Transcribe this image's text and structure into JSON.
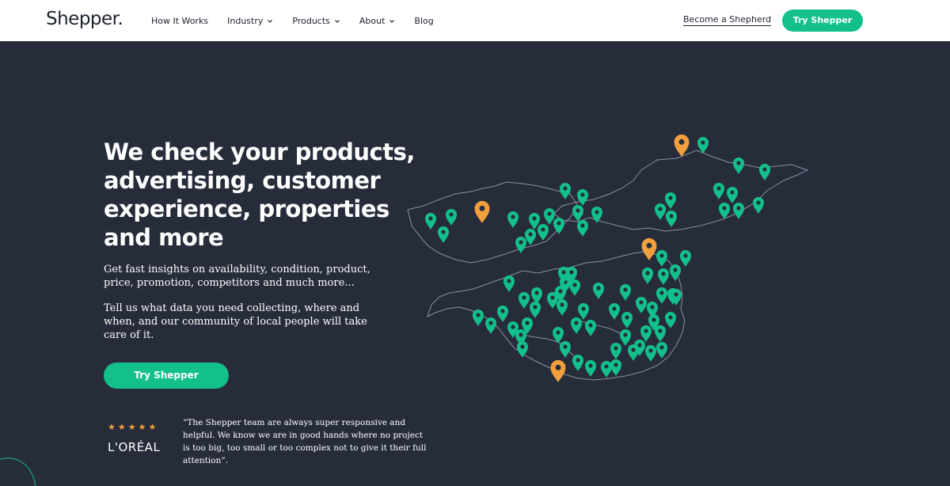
{
  "header": {
    "logo": "Shepper",
    "nav": [
      {
        "label": "How It Works",
        "has_dropdown": false
      },
      {
        "label": "Industry",
        "has_dropdown": true
      },
      {
        "label": "Products",
        "has_dropdown": true
      },
      {
        "label": "About",
        "has_dropdown": true
      },
      {
        "label": "Blog",
        "has_dropdown": false
      }
    ],
    "become_link": "Become a Shepherd",
    "cta": "Try Shepper"
  },
  "hero": {
    "title_lines": [
      "We check your products,",
      "advertising, customer",
      "experience, properties",
      "and more"
    ],
    "para1_lines": [
      "Get fast insights on availability, condition, product,",
      "price, promotion, competitors and much more..."
    ],
    "para2_lines": [
      "Tell us what data you need collecting, where and",
      "when, and our community of local people will take",
      "care of it."
    ],
    "cta": "Try Shepper"
  },
  "testimonial": {
    "stars": "★★★★★",
    "brand": "L'ORÉAL",
    "quote_lines": [
      "“The Shepper team are always super responsive and",
      "helpful. We know we are in good hands where no project",
      "is too big, too small or too complex not to give it their full",
      "attention”."
    ]
  },
  "map": {
    "pin_colors": {
      "primary": "#13c08b",
      "highlight": "#f2a03d"
    },
    "outline_color": "#8a90a0",
    "icon": "location-pin-icon"
  },
  "colors": {
    "accent": "#13c08b",
    "background": "#272c3b",
    "star": "#f2a03d"
  }
}
